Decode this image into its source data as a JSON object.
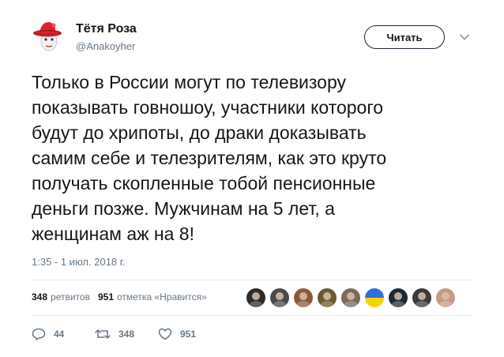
{
  "user": {
    "name": "Тётя Роза",
    "handle": "@Anakoyher",
    "avatar_icon": "red-hat-avatar-icon"
  },
  "follow_button": {
    "label": "Читать"
  },
  "menu_icon": "chevron-down-icon",
  "tweet": {
    "text": "Только в России могут по телевизору\nпоказывать говношоу, участники которого\nбудут до хрипоты, до драки доказывать\nсамим себе и телезрителям, как это круто\nполучать скопленные тобой пенсионные\nденьги позже. Мужчинам на 5 лет, а\nженщинам аж на 8!",
    "timestamp": "1:35 - 1 июл. 2018 г."
  },
  "stats": {
    "retweets_count": "348",
    "retweets_label": "ретвитов",
    "likes_count": "951",
    "likes_label": "отметка «Нравится»"
  },
  "likers": [
    {
      "icon": "liker-avatar-1",
      "color": "#2b2b2b"
    },
    {
      "icon": "liker-avatar-2",
      "color": "#4a4a4a"
    },
    {
      "icon": "liker-avatar-3",
      "color": "#8a5a3c"
    },
    {
      "icon": "liker-avatar-4",
      "color": "#6b5a2e"
    },
    {
      "icon": "liker-avatar-5",
      "color": "#7a6a5a"
    },
    {
      "icon": "liker-avatar-6-ukraine-flag",
      "color": "#2f6fd6"
    },
    {
      "icon": "liker-avatar-7",
      "color": "#1c2a3a"
    },
    {
      "icon": "liker-avatar-8",
      "color": "#3a3a3a"
    },
    {
      "icon": "liker-avatar-9",
      "color": "#c49a86"
    }
  ],
  "actions": {
    "reply_count": "44",
    "retweet_count": "348",
    "like_count": "951"
  },
  "colors": {
    "text": "#14171a",
    "secondary": "#657786",
    "divider": "#e6ecf0",
    "hat_red": "#d9232e"
  }
}
